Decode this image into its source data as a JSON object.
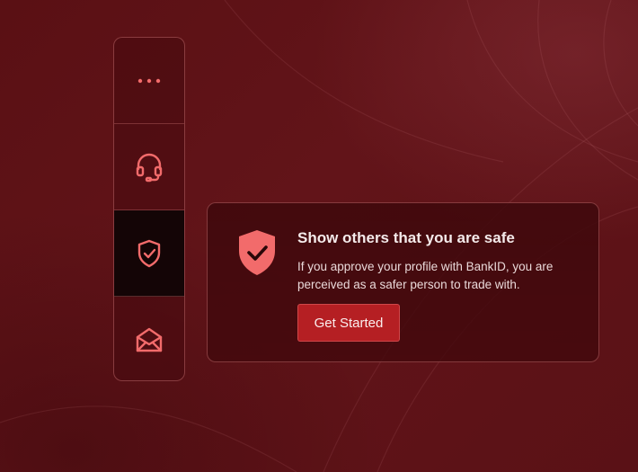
{
  "sidebar": {
    "items": [
      {
        "icon": "more-dots-icon",
        "active": false
      },
      {
        "icon": "headset-icon",
        "active": false
      },
      {
        "icon": "shield-check-icon",
        "active": true
      },
      {
        "icon": "open-envelope-icon",
        "active": false
      }
    ]
  },
  "card": {
    "icon": "shield-check-icon",
    "title": "Show others that you are safe",
    "text": "If you approve your profile with BankID, you are perceived as a safer person to trade with.",
    "cta_label": "Get Started"
  },
  "colors": {
    "background": "#5b1115",
    "accent": "#f26b6b",
    "button": "#b51f23",
    "active_item": "#140506"
  }
}
